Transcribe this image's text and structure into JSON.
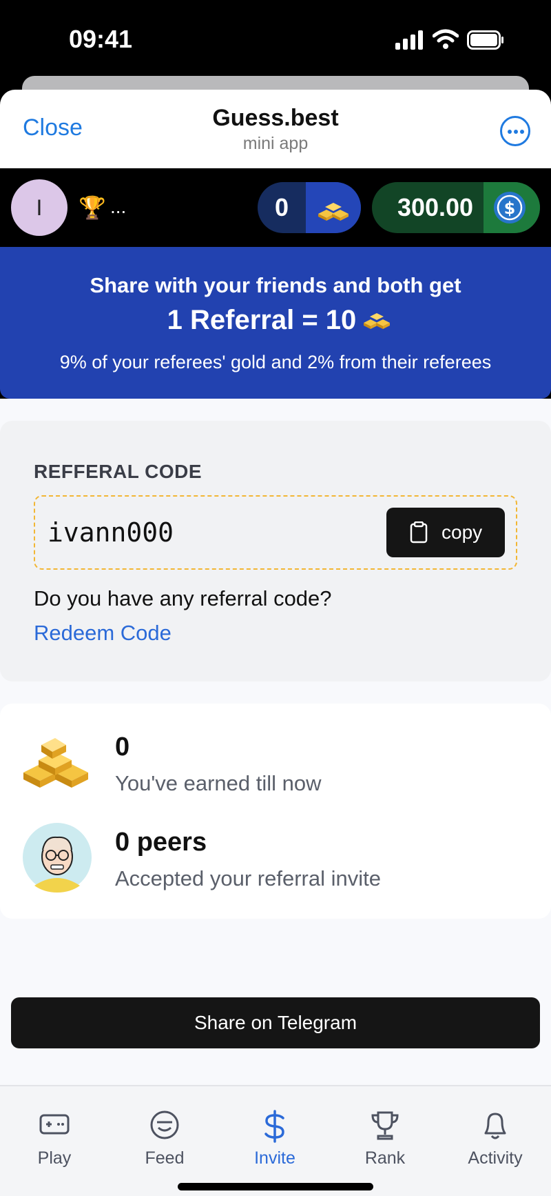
{
  "status_bar": {
    "time": "09:41",
    "icons": [
      "signal-icon",
      "wifi-icon",
      "battery-icon"
    ]
  },
  "header": {
    "close_label": "Close",
    "title": "Guess.best",
    "subtitle": "mini app",
    "more_icon": "more-icon"
  },
  "topbar": {
    "avatar_initial": "I",
    "rank_icon": "trophy-icon",
    "rank_text": "...",
    "gold_value": "0",
    "gold_icon": "gold-bars-icon",
    "usd_value": "300.00",
    "usd_icon": "usd-coin-icon"
  },
  "banner": {
    "line1": "Share with your friends and both get",
    "line2": "1 Referral = 10",
    "line3": "9% of your referees' gold and 2% from their referees"
  },
  "referral": {
    "label": "REFFERAL CODE",
    "code": "ivann000",
    "copy_label": "copy",
    "question": "Do you have any referral code?",
    "redeem_label": "Redeem Code"
  },
  "stats": {
    "earned_value": "0",
    "earned_caption": "You've earned till now",
    "peers_value": "0 peers",
    "peers_caption": "Accepted your referral invite"
  },
  "share_button_label": "Share on Telegram",
  "nav": {
    "items": [
      {
        "label": "Play",
        "icon": "gamepad-icon"
      },
      {
        "label": "Feed",
        "icon": "smile-icon"
      },
      {
        "label": "Invite",
        "icon": "dollar-icon",
        "active": true
      },
      {
        "label": "Rank",
        "icon": "trophy-icon"
      },
      {
        "label": "Activity",
        "icon": "bell-icon"
      }
    ]
  },
  "colors": {
    "accent": "#2b6ad8",
    "banner": "#2242b0",
    "gold_pill": "#162c5f",
    "usd_pill": "#124526",
    "dashed_border": "#f2b633"
  }
}
